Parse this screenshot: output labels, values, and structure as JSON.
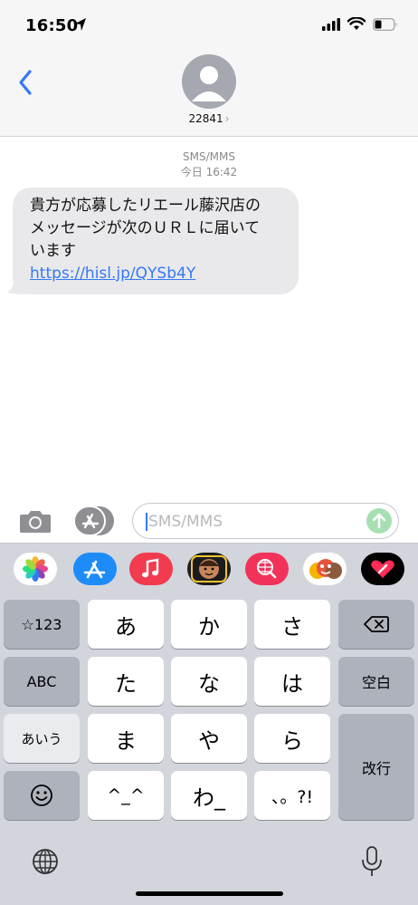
{
  "status_bar": {
    "time": "16:50"
  },
  "header": {
    "contact": "22841",
    "chevron": "›"
  },
  "conversation": {
    "message_type": "SMS/MMS",
    "date": "今日 16:42",
    "message": {
      "lines": [
        "貴方が応募したリエール藤沢店の",
        "メッセージが次のＵＲＬに届いて",
        "います"
      ],
      "link": "https://hisl.jp/QYSb4Y"
    }
  },
  "input": {
    "placeholder": "SMS/MMS"
  },
  "app_drawer": [
    "photos-app",
    "app-store-app",
    "music-app",
    "memoji-app",
    "images-search-app",
    "animoji-stickers-app",
    "digital-touch-app"
  ],
  "keyboard": {
    "row1": {
      "mode": "☆123",
      "k1": "あ",
      "k2": "か",
      "k3": "さ"
    },
    "row2": {
      "mode": "ABC",
      "k1": "た",
      "k2": "な",
      "k3": "は",
      "space": "空白"
    },
    "row3": {
      "mode": "あいう",
      "k1": "ま",
      "k2": "や",
      "k3": "ら",
      "return": "改行"
    },
    "row4": {
      "k1": "^_^",
      "k2": "わ_",
      "k3": "、。?!"
    }
  },
  "colors": {
    "accent": "#3478f6",
    "bubble": "#e9e9eb",
    "keyboard_bg": "#d3d5dc",
    "dark_key": "#aeb2bb",
    "send_inactive": "#a6e0b2"
  }
}
